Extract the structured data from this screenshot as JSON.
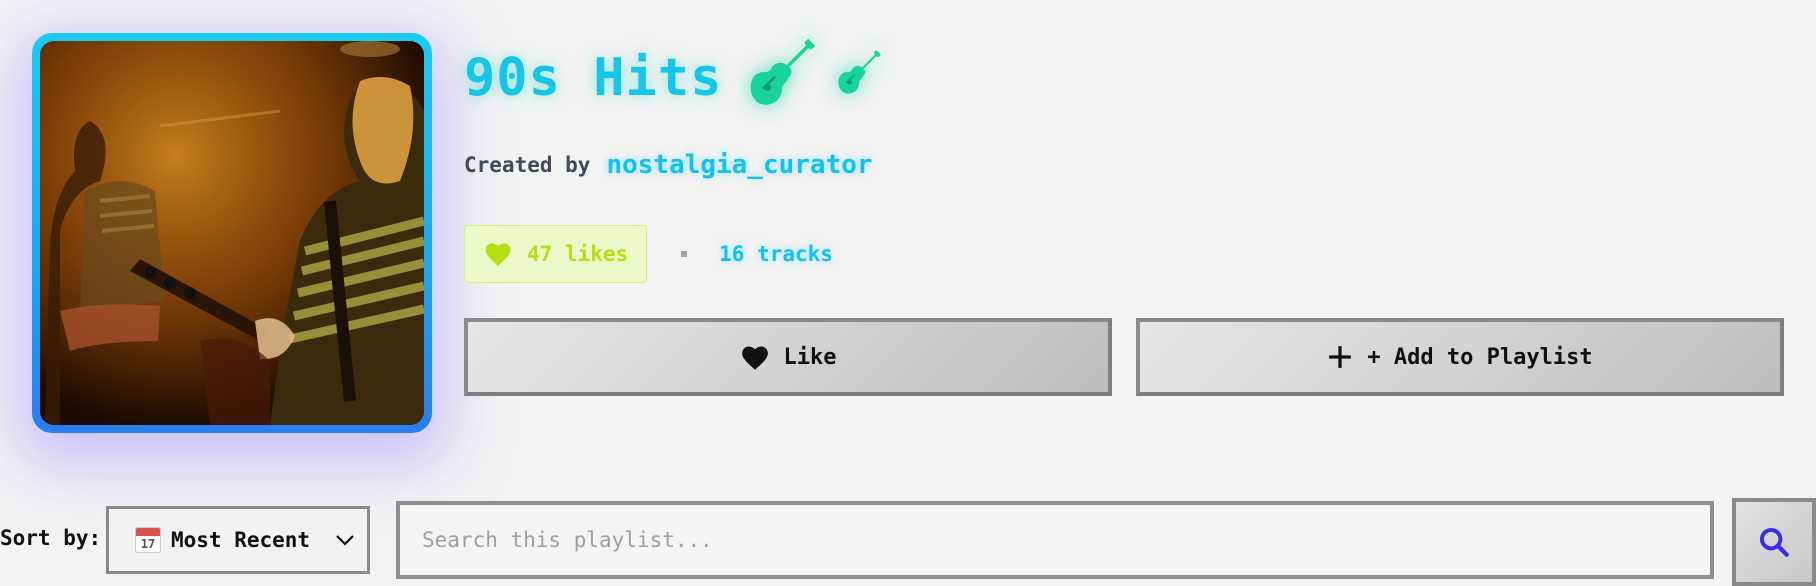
{
  "playlist": {
    "title": "90s Hits",
    "title_icons": [
      "guitar-icon",
      "guitar-icon"
    ],
    "created_by_label": "Created by",
    "creator": "nostalgia_curator",
    "likes": "47 likes",
    "tracks": "16 tracks"
  },
  "actions": {
    "like_label": "Like",
    "add_label": "+ Add to Playlist"
  },
  "controls": {
    "sort_label": "Sort by:",
    "sort_selected": "Most Recent",
    "calendar_day": "17",
    "search_placeholder": "Search this playlist..."
  },
  "colors": {
    "accent_cyan": "#17c6e6",
    "guitar_green": "#18d49a",
    "likes_lime": "#b6de12",
    "search_icon_blue": "#3a2cf0"
  }
}
